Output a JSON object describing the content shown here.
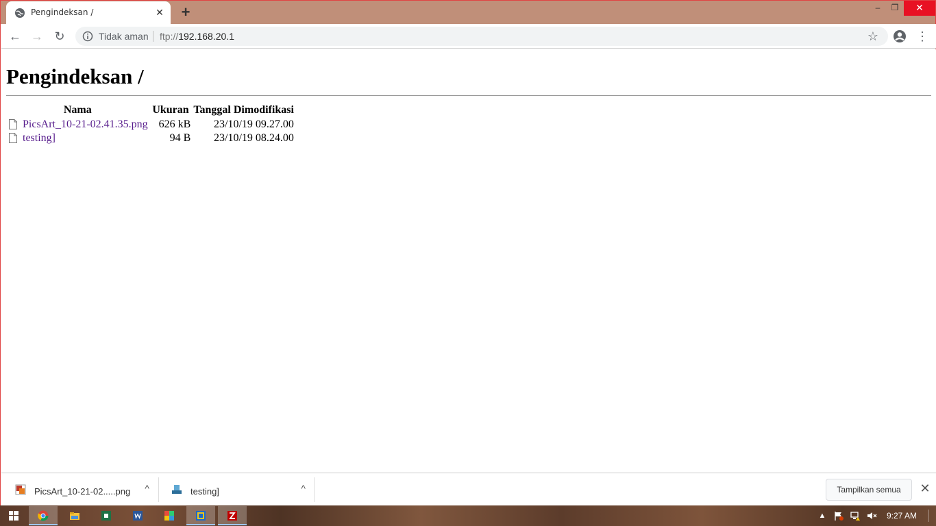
{
  "browser": {
    "tab": {
      "title": "Pengindeksan /",
      "favicon": "globe-icon"
    },
    "new_tab_symbol": "+",
    "window_controls": {
      "minimize": "–",
      "maximize": "❐",
      "close": "✕"
    },
    "nav": {
      "back": "←",
      "forward": "→",
      "reload": "↻"
    },
    "omnibox": {
      "security_label": "Tidak aman",
      "url_scheme": "ftp://",
      "url_host": "192.168.20.1"
    },
    "bookmark_symbol": "☆",
    "menu_symbol": "⋮"
  },
  "page": {
    "title": "Pengindeksan /",
    "columns": [
      "Nama",
      "Ukuran",
      "Tanggal Dimodifikasi"
    ],
    "files": [
      {
        "name": "PicsArt_10-21-02.41.35.png",
        "size": "626 kB",
        "modified": "23/10/19 09.27.00"
      },
      {
        "name": "testing]",
        "size": "94 B",
        "modified": "23/10/19 08.24.00"
      }
    ]
  },
  "downloads": {
    "items": [
      {
        "name": "PicsArt_10-21-02.....png",
        "icon": "image-file-icon"
      },
      {
        "name": "testing]",
        "icon": "generic-file-icon"
      }
    ],
    "caret": "^",
    "show_all_label": "Tampilkan semua",
    "close_symbol": "✕"
  },
  "taskbar": {
    "apps": [
      "chrome",
      "file-explorer",
      "excel",
      "word",
      "paint",
      "virtualbox",
      "filezilla"
    ],
    "clock": "9:27 AM",
    "tray_caret": "▲"
  },
  "colors": {
    "tabstrip": "#c08f79",
    "link_visited": "#551a8b",
    "frame_border": "#e04343"
  }
}
